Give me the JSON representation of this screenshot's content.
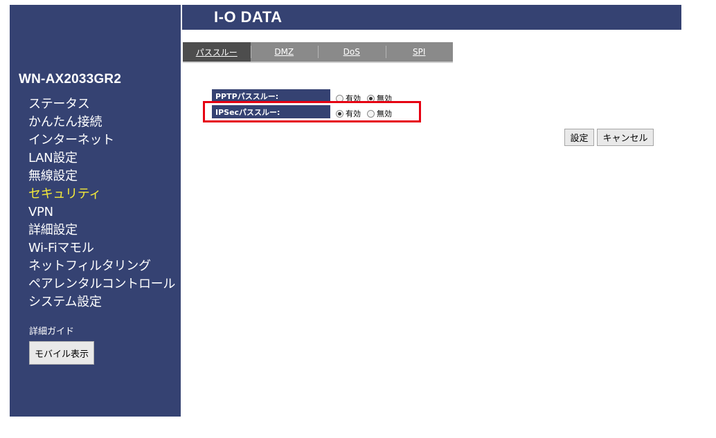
{
  "header": {
    "logo_text": "I-O DATA"
  },
  "sidebar": {
    "model": "WN-AX2033GR2",
    "menu": [
      "ステータス",
      "かんたん接続",
      "インターネット",
      "LAN設定",
      "無線設定",
      "セキュリティ",
      "VPN",
      "詳細設定",
      "Wi-Fiマモル",
      "ネットフィルタリング",
      "ペアレンタルコントロール",
      "システム設定"
    ],
    "active_item": "セキュリティ",
    "guide": "詳細ガイド",
    "mobile_button": "モバイル表示"
  },
  "tabs": [
    "パススルー",
    "DMZ",
    "DoS",
    "SPI"
  ],
  "active_tab": "パススルー",
  "settings": {
    "pptp": {
      "label": "PPTPパススルー:",
      "enabled_label": "有効",
      "disabled_label": "無効",
      "value": "無効"
    },
    "ipsec": {
      "label": "IPSecパススルー:",
      "enabled_label": "有効",
      "disabled_label": "無効",
      "value": "有効"
    }
  },
  "buttons": {
    "apply": "設定",
    "cancel": "キャンセル"
  },
  "colors": {
    "navy": "#354272",
    "active_menu": "#f3e83a",
    "highlight": "#e60012",
    "tab_bar": "#8a8a8a",
    "tab_active": "#4d4d4d"
  }
}
